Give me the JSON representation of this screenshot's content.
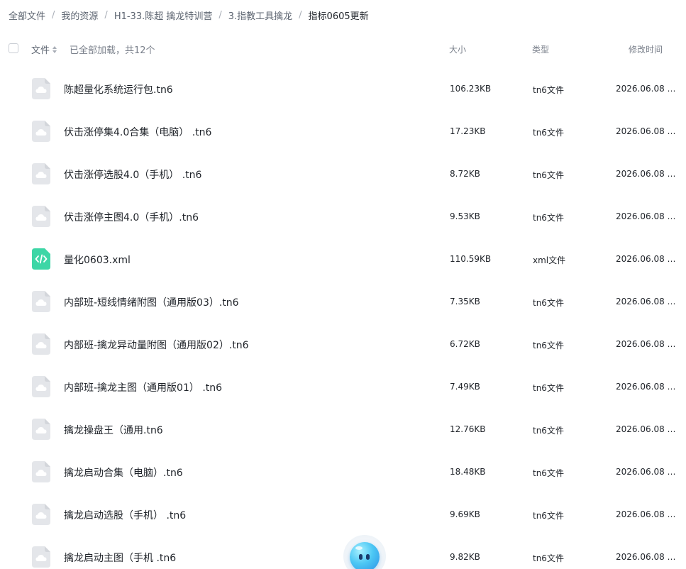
{
  "breadcrumb": [
    {
      "label": "全部文件"
    },
    {
      "label": "我的资源"
    },
    {
      "label": "H1-33.陈超 擒龙特训营"
    },
    {
      "label": "3.指教工具擒龙"
    },
    {
      "label": "指标0605更新"
    }
  ],
  "header": {
    "name_label": "文件",
    "count_label": "已全部加载，共12个",
    "size_label": "大小",
    "type_label": "类型",
    "time_label": "修改时间"
  },
  "files": [
    {
      "name": "陈超量化系统运行包.tn6",
      "size": "106.23KB",
      "type": "tn6文件",
      "time": "2026.06.08 1...",
      "icon": "cloud-file-icon"
    },
    {
      "name": "伏击涨停集4.0合集（电脑） .tn6",
      "size": "17.23KB",
      "type": "tn6文件",
      "time": "2026.06.08 1...",
      "icon": "cloud-file-icon"
    },
    {
      "name": "伏击涨停选股4.0（手机） .tn6",
      "size": "8.72KB",
      "type": "tn6文件",
      "time": "2026.06.08 1...",
      "icon": "cloud-file-icon"
    },
    {
      "name": "伏击涨停主图4.0（手机）.tn6",
      "size": "9.53KB",
      "type": "tn6文件",
      "time": "2026.06.08 1...",
      "icon": "cloud-file-icon"
    },
    {
      "name": "量化0603.xml",
      "size": "110.59KB",
      "type": "xml文件",
      "time": "2026.06.08 1...",
      "icon": "code-file-icon"
    },
    {
      "name": "内部班-短线情绪附图（通用版03）.tn6",
      "size": "7.35KB",
      "type": "tn6文件",
      "time": "2026.06.08 1...",
      "icon": "cloud-file-icon"
    },
    {
      "name": "内部班-擒龙异动量附图（通用版02）.tn6",
      "size": "6.72KB",
      "type": "tn6文件",
      "time": "2026.06.08 1...",
      "icon": "cloud-file-icon"
    },
    {
      "name": "内部班-擒龙主图（通用版01） .tn6",
      "size": "7.49KB",
      "type": "tn6文件",
      "time": "2026.06.08 1...",
      "icon": "cloud-file-icon"
    },
    {
      "name": "擒龙操盘王（通用.tn6",
      "size": "12.76KB",
      "type": "tn6文件",
      "time": "2026.06.08 1...",
      "icon": "cloud-file-icon"
    },
    {
      "name": "擒龙启动合集（电脑）.tn6",
      "size": "18.48KB",
      "type": "tn6文件",
      "time": "2026.06.08 1...",
      "icon": "cloud-file-icon"
    },
    {
      "name": "擒龙启动选股（手机） .tn6",
      "size": "9.69KB",
      "type": "tn6文件",
      "time": "2026.06.08 1...",
      "icon": "cloud-file-icon"
    },
    {
      "name": "擒龙启动主图（手机 .tn6",
      "size": "9.82KB",
      "type": "tn6文件",
      "time": "2026.06.08 1...",
      "icon": "cloud-file-icon"
    }
  ],
  "colors": {
    "generic_icon_bg": "#e4e6ea",
    "generic_icon_glyph": "#ffffff",
    "xml_icon_bg": "#3dd6a6"
  },
  "assistant": {
    "icon": "assistant-mascot-icon"
  }
}
